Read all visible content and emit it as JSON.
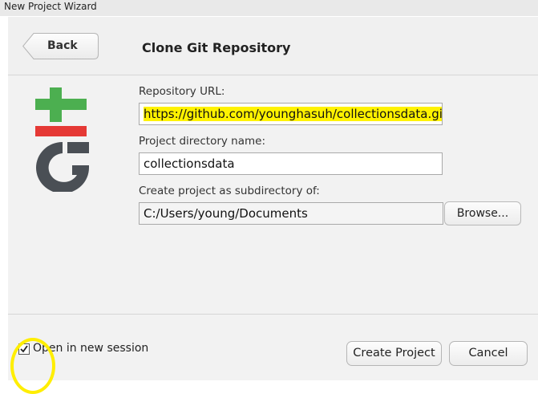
{
  "window": {
    "title": "New Project Wizard"
  },
  "header": {
    "back_label": "Back",
    "title": "Clone Git Repository"
  },
  "form": {
    "repo_url_label": "Repository URL:",
    "repo_url_value": "https://github.com/younghasuh/collectionsdata.git",
    "dir_name_label": "Project directory name:",
    "dir_name_value": "collectionsdata",
    "subdir_label": "Create project as subdirectory of:",
    "subdir_value": "C:/Users/young/Documents",
    "browse_label": "Browse..."
  },
  "footer": {
    "open_new_session_label": "Open in new session",
    "open_new_session_checked": true,
    "create_label": "Create Project",
    "cancel_label": "Cancel"
  },
  "colors": {
    "git_plus_green": "#4caf50",
    "git_minus_red": "#e53935",
    "git_logo_gray": "#4a4f55",
    "annotation_yellow": "#fff200"
  },
  "icons": {
    "logo": "git-logo-icon",
    "back": "back-arrow-button-shape",
    "checkmark": "checkmark-icon"
  }
}
